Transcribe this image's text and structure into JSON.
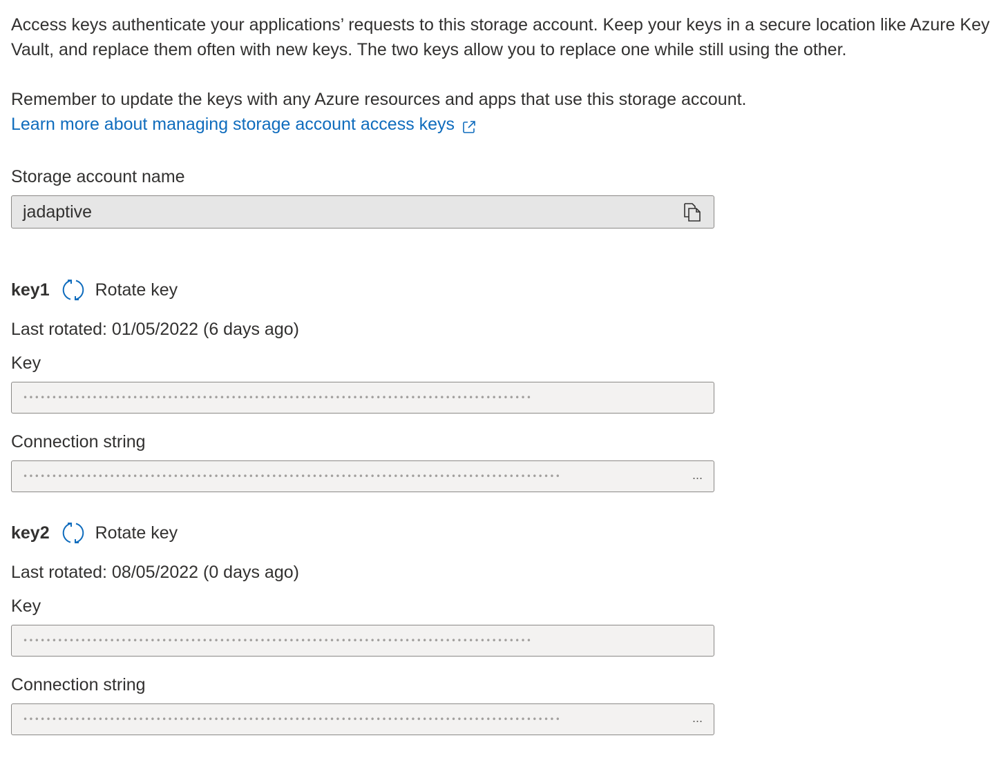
{
  "intro": {
    "text": "Access keys authenticate your applications’ requests to this storage account. Keep your keys in a secure location like Azure Key Vault, and replace them often with new keys. The two keys allow you to replace one while still using the other.",
    "remember": "Remember to update the keys with any Azure resources and apps that use this storage account.",
    "learn_more": "Learn more about managing storage account access keys"
  },
  "storage_account": {
    "label": "Storage account name",
    "value": "jadaptive"
  },
  "keys": [
    {
      "name": "key1",
      "rotate_label": "Rotate key",
      "last_rotated": "Last rotated: 01/05/2022 (6 days ago)",
      "key_label": "Key",
      "key_masked": "••••••••••••••••••••••••••••••••••••••••••••••••••••••••••••••••••••••••••••••••••••••••",
      "conn_label": "Connection string",
      "conn_masked": "•••••••••••••••••••••••••••••••••••••••••••••••••••••••••••••••••••••••••••••••••••••••••••••",
      "conn_ellipsis": "..."
    },
    {
      "name": "key2",
      "rotate_label": "Rotate key",
      "last_rotated": "Last rotated: 08/05/2022 (0 days ago)",
      "key_label": "Key",
      "key_masked": "••••••••••••••••••••••••••••••••••••••••••••••••••••••••••••••••••••••••••••••••••••••••",
      "conn_label": "Connection string",
      "conn_masked": "•••••••••••••••••••••••••••••••••••••••••••••••••••••••••••••••••••••••••••••••••••••••••••••",
      "conn_ellipsis": "..."
    }
  ],
  "icons": {
    "external_link": "external-link-icon",
    "copy": "copy-icon",
    "rotate": "rotate-icon"
  },
  "colors": {
    "link": "#0f6cbd",
    "text": "#323130",
    "field_bg": "#f3f2f1",
    "readonly_bg": "#e6e6e6",
    "border": "#8a8886"
  }
}
